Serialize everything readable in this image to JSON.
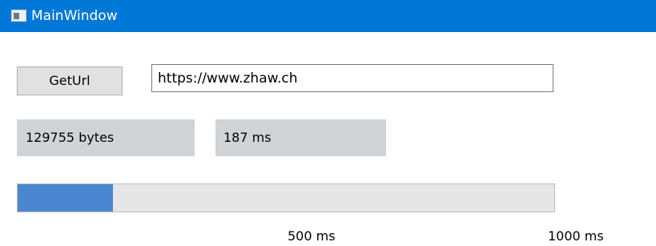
{
  "window": {
    "title": "MainWindow",
    "icon": "app-window-icon"
  },
  "controls": {
    "get_url_label": "GetUrl",
    "url_value": "https://www.zhaw.ch"
  },
  "results": {
    "bytes_text": "129755 bytes",
    "time_text": "187 ms"
  },
  "progress": {
    "fraction": 0.178,
    "fill_color": "#4a86d1",
    "track_color": "#e6e6e6",
    "tick_500": "500 ms",
    "tick_1000": "1000 ms"
  },
  "colors": {
    "titlebar": "#0078d7",
    "label_background": "#d1d4d6"
  }
}
